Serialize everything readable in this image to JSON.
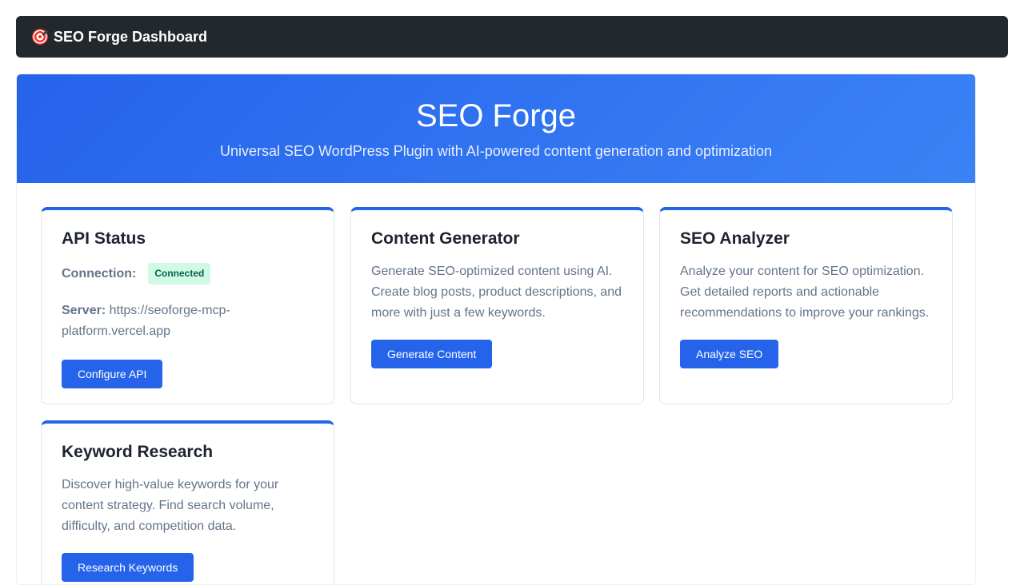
{
  "header": {
    "title": "SEO Forge Dashboard",
    "icon": "target-icon"
  },
  "hero": {
    "title": "SEO Forge",
    "subtitle": "Universal SEO WordPress Plugin with AI-powered content generation and optimization"
  },
  "cards": {
    "api_status": {
      "title": "API Status",
      "connection_label": "Connection:",
      "connection_badge": "Connected",
      "server_label": "Server:",
      "server_url": "https://seoforge-mcp-platform.vercel.app",
      "button": "Configure API"
    },
    "content_generator": {
      "title": "Content Generator",
      "description": "Generate SEO-optimized content using AI. Create blog posts, product descriptions, and more with just a few keywords.",
      "button": "Generate Content"
    },
    "seo_analyzer": {
      "title": "SEO Analyzer",
      "description": "Analyze your content for SEO optimization. Get detailed reports and actionable recommendations to improve your rankings.",
      "button": "Analyze SEO"
    },
    "keyword_research": {
      "title": "Keyword Research",
      "description": "Discover high-value keywords for your content strategy. Find search volume, difficulty, and competition data.",
      "button": "Research Keywords"
    }
  },
  "colors": {
    "accent": "#2563eb",
    "topbar": "#23282d",
    "badge_bg": "#d1fae5",
    "badge_text": "#065f46"
  }
}
